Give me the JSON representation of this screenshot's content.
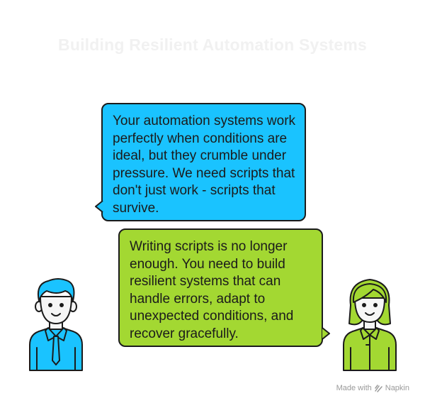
{
  "title": "Building Resilient Automation Systems",
  "messages": [
    {
      "speaker": "left",
      "color": "#1ac3ff",
      "text": "Your automation systems work perfectly when conditions are ideal, but they crumble under pressure. We need scripts that don't just work - scripts that survive."
    },
    {
      "speaker": "right",
      "color": "#a3d832",
      "text": "Writing scripts is no longer enough. You need to build resilient systems that can handle errors, adapt to unexpected conditions, and recover gracefully."
    }
  ],
  "people": [
    {
      "name": "man",
      "color": "#1ac3ff"
    },
    {
      "name": "woman",
      "color": "#a3d832"
    }
  ],
  "footer": {
    "made_with": "Made with",
    "brand": "Napkin"
  }
}
